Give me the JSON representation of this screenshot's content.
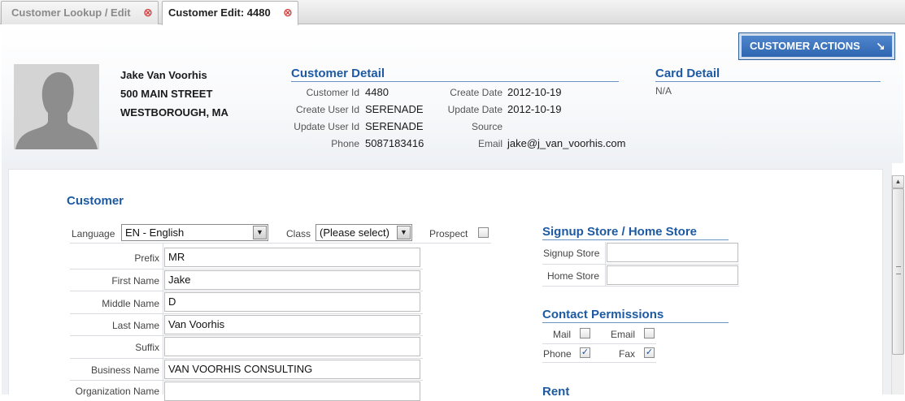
{
  "tabs": [
    {
      "label": "Customer Lookup / Edit",
      "active": false
    },
    {
      "label": "Customer Edit: 4480",
      "active": true
    }
  ],
  "header": {
    "actions_button": "CUSTOMER ACTIONS",
    "customer": {
      "name": "Jake Van Voorhis",
      "address1": "500 MAIN STREET",
      "address2": "WESTBOROUGH, MA"
    },
    "customer_detail": {
      "title": "Customer Detail",
      "customer_id_label": "Customer Id",
      "customer_id": "4480",
      "create_user_label": "Create User Id",
      "create_user": "SERENADE",
      "update_user_label": "Update User Id",
      "update_user": "SERENADE",
      "phone_label": "Phone",
      "phone": "5087183416",
      "create_date_label": "Create Date",
      "create_date": "2012-10-19",
      "update_date_label": "Update Date",
      "update_date": "2012-10-19",
      "source_label": "Source",
      "source": "",
      "email_label": "Email",
      "email": "jake@j_van_voorhis.com"
    },
    "card_detail": {
      "title": "Card Detail",
      "value": "N/A"
    }
  },
  "form": {
    "title": "Customer",
    "language_label": "Language",
    "language_value": "EN - English",
    "class_label": "Class",
    "class_value": "(Please select)",
    "prospect_label": "Prospect",
    "prospect_checked": false,
    "fields": [
      {
        "label": "Prefix",
        "value": "MR"
      },
      {
        "label": "First Name",
        "value": "Jake"
      },
      {
        "label": "Middle Name",
        "value": "D"
      },
      {
        "label": "Last Name",
        "value": "Van Voorhis"
      },
      {
        "label": "Suffix",
        "value": ""
      },
      {
        "label": "Business Name",
        "value": "VAN VOORHIS CONSULTING"
      },
      {
        "label": "Organization Name",
        "value": ""
      }
    ]
  },
  "signup": {
    "title": "Signup Store / Home Store",
    "signup_label": "Signup Store",
    "signup_value": "",
    "home_label": "Home Store",
    "home_value": ""
  },
  "permissions": {
    "title": "Contact Permissions",
    "mail_label": "Mail",
    "mail": false,
    "email_label": "Email",
    "email": false,
    "phone_label": "Phone",
    "phone": true,
    "fax_label": "Fax",
    "fax": true
  },
  "rent": {
    "title": "Rent"
  },
  "icons": {
    "close": "close-circle-icon",
    "actions_arrow": "arrow-down-right-icon",
    "dropdown": "chevron-down-icon"
  },
  "colors": {
    "accent": "#1d5aa2",
    "button": "#3a70bb",
    "close": "#d23b3b"
  }
}
